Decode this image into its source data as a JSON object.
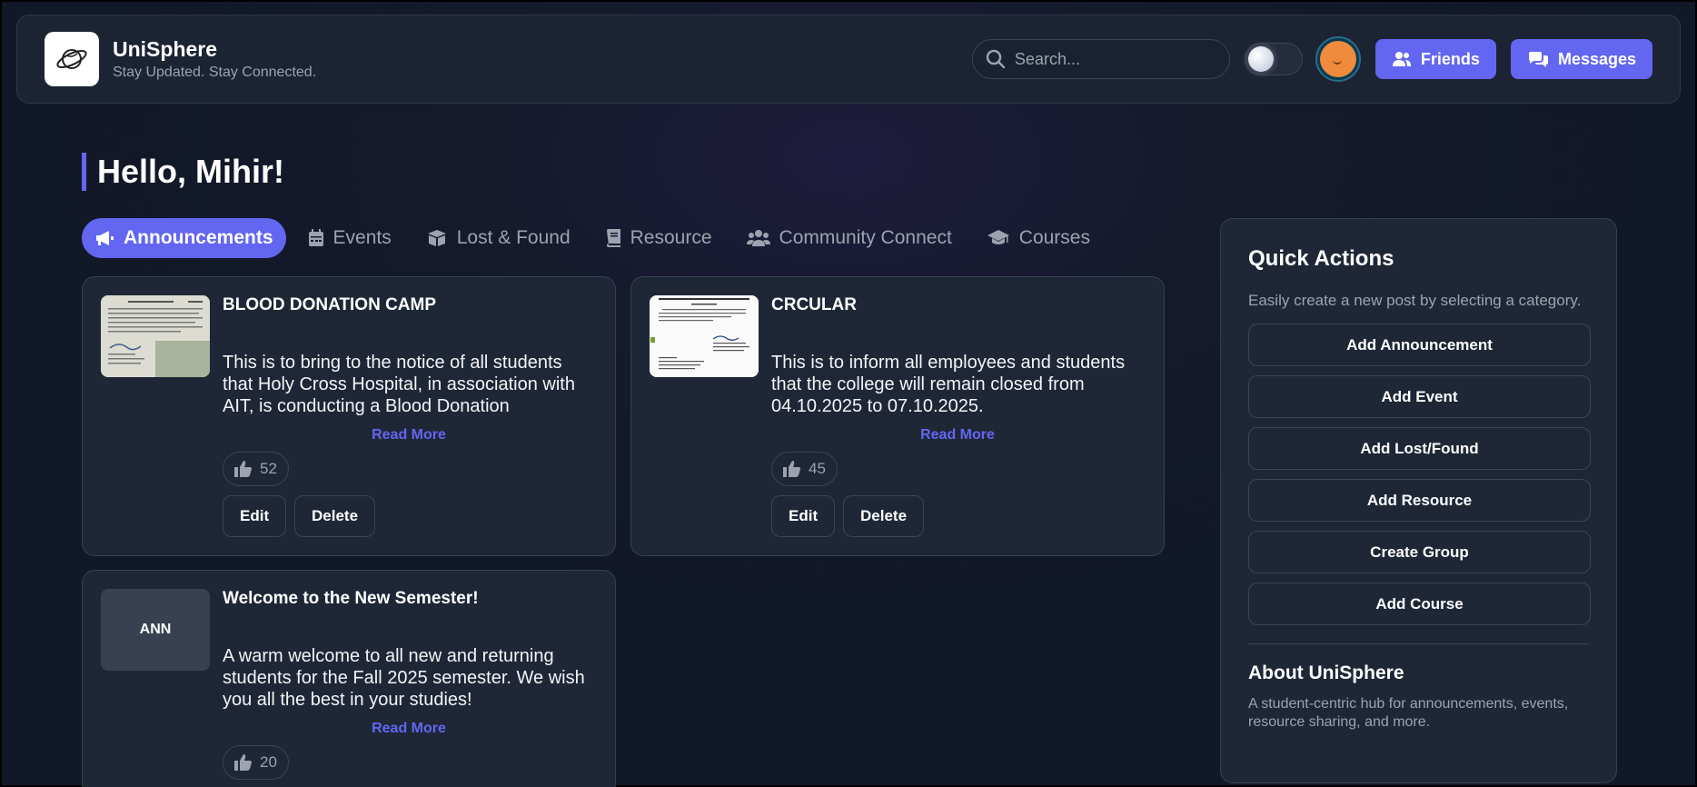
{
  "header": {
    "app_name": "UniSphere",
    "tagline": "Stay Updated. Stay Connected.",
    "search_placeholder": "Search...",
    "friends_label": "Friends",
    "messages_label": "Messages"
  },
  "greeting": "Hello, Mihir!",
  "tabs": [
    {
      "label": "Announcements",
      "icon": "megaphone-icon",
      "active": true
    },
    {
      "label": "Events",
      "icon": "calendar-icon"
    },
    {
      "label": "Lost & Found",
      "icon": "box-icon"
    },
    {
      "label": "Resource",
      "icon": "book-icon"
    },
    {
      "label": "Community Connect",
      "icon": "users-icon"
    },
    {
      "label": "Courses",
      "icon": "graduation-cap-icon"
    }
  ],
  "posts": [
    {
      "title": "BLOOD DONATION CAMP",
      "body": "This is to bring to the notice of all students that Holy Cross Hospital, in association with AIT, is conducting a Blood Donation",
      "read_more": "Read More",
      "likes": "52",
      "edit": "Edit",
      "delete": "Delete"
    },
    {
      "title": "CRCULAR",
      "body": "This is to inform all employees and students that the college will remain closed from 04.10.2025 to 07.10.2025.",
      "read_more": "Read More",
      "likes": "45",
      "edit": "Edit",
      "delete": "Delete"
    },
    {
      "title": "Welcome to the New Semester!",
      "thumb_label": "ANN",
      "body": "A warm welcome to all new and returning students for the Fall 2025 semester. We wish you all the best in your studies!",
      "read_more": "Read More",
      "likes": "20"
    }
  ],
  "quick_actions": {
    "title": "Quick Actions",
    "subtitle": "Easily create a new post by selecting a category.",
    "buttons": [
      "Add Announcement",
      "Add Event",
      "Add Lost/Found",
      "Add Resource",
      "Create Group",
      "Add Course"
    ],
    "about_title": "About UniSphere",
    "about_text": "A student-centric hub for announcements, events, resource sharing, and more."
  },
  "colors": {
    "accent": "#6366f1",
    "card_bg": "#1f2737",
    "page_bg": "#111827"
  }
}
